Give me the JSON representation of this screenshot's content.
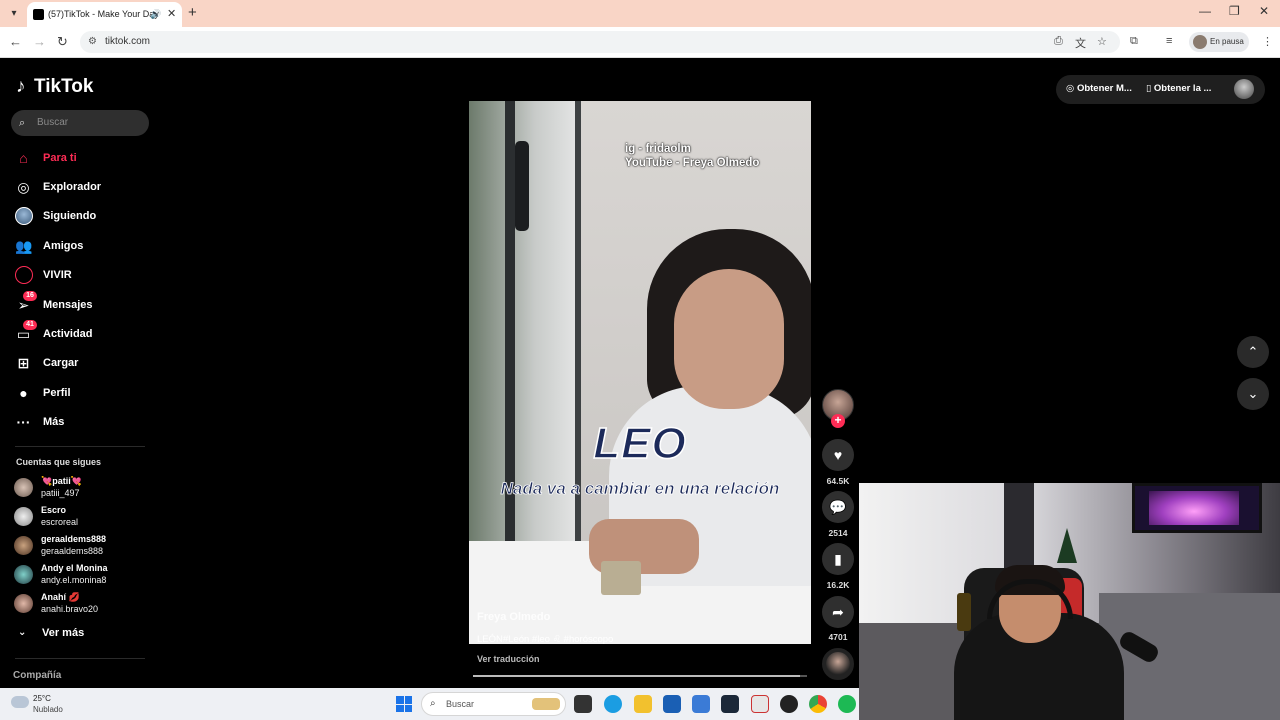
{
  "browser": {
    "tab_title": "(57)TikTok - Make Your Day",
    "url": "tiktok.com",
    "profile_status": "En pausa"
  },
  "tiktok": {
    "logo": "TikTok",
    "search_placeholder": "Buscar",
    "nav": [
      {
        "label": "Para ti",
        "icon": "home-icon"
      },
      {
        "label": "Explorador",
        "icon": "compass-icon"
      },
      {
        "label": "Siguiendo",
        "icon": "following-avatar"
      },
      {
        "label": "Amigos",
        "icon": "friends-icon"
      },
      {
        "label": "VIVIR",
        "icon": "live-icon"
      },
      {
        "label": "Mensajes",
        "icon": "messages-icon",
        "badge": "16"
      },
      {
        "label": "Actividad",
        "icon": "activity-icon",
        "badge": "41"
      },
      {
        "label": "Cargar",
        "icon": "upload-icon"
      },
      {
        "label": "Perfil",
        "icon": "profile-avatar"
      },
      {
        "label": "Más",
        "icon": "more-icon"
      }
    ],
    "following_title": "Cuentas que sigues",
    "accounts": [
      {
        "name": "💘patii💘",
        "username": "patiii_497"
      },
      {
        "name": "Escro",
        "username": "escroreal"
      },
      {
        "name": "geraaldems888",
        "username": "geraaldems888"
      },
      {
        "name": "Andy el Monina",
        "username": "andy.el.monina8"
      },
      {
        "name": "Anahí 💋",
        "username": "anahi.bravo20"
      }
    ],
    "see_more": "Ver más",
    "company": "Compañía",
    "top_right": {
      "coins": "Obtener M...",
      "app": "Obtener la ..."
    }
  },
  "video": {
    "overlay_line1": "ig - fridaolm",
    "overlay_line2": "YouTube - Freya Olmedo",
    "title_text": "LEO",
    "subtitle_text": "Nada va a cambiar en una relación",
    "author": "Freya Olmedo",
    "caption": "LEÓN#León #leo ♌ #horóscopo",
    "translate": "Ver traducción",
    "progress": 0.98,
    "likes": "64.5K",
    "comments": "2514",
    "saves": "16.2K",
    "shares": "4701"
  },
  "taskbar": {
    "temperature": "25°C",
    "condition": "Nublado",
    "search_label": "Buscar"
  },
  "colors": {
    "accent": "#fe2c55",
    "tab_bar": "#f9d5c6",
    "background": "#000000"
  }
}
